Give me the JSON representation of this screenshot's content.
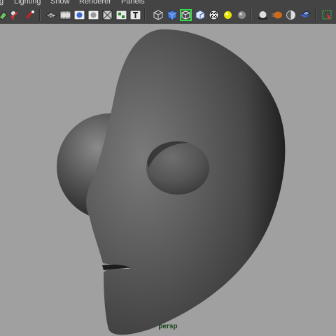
{
  "menu": {
    "items": [
      {
        "label": "g"
      },
      {
        "label": "Lighting"
      },
      {
        "label": "Show"
      },
      {
        "label": "Renderer"
      },
      {
        "label": "Panels"
      }
    ]
  },
  "toolbar": {
    "icons": [
      "select-camera-icon",
      "bookmark-icon",
      "image-plane-icon",
      "grid-icon",
      "film-gate-icon",
      "resolution-gate-icon",
      "gate-mask-icon",
      "field-chart-icon",
      "safe-action-icon",
      "safe-title-icon",
      "wireframe-icon",
      "smooth-shade-icon",
      "shaded-wireframe-icon",
      "default-material-icon",
      "textured-icon",
      "use-lights-icon",
      "shadows-icon",
      "ambient-occlusion-icon",
      "motion-blur-icon",
      "antialias-icon",
      "depth-of-field-icon",
      "isolate-select-icon"
    ],
    "active_icon": "shaded-wireframe-icon",
    "active_color": "#33dd44"
  },
  "viewport": {
    "camera_label": "persp",
    "background_color": "#a0a0a0",
    "label_color": "#0f3d0f",
    "scene": "mask-model"
  }
}
